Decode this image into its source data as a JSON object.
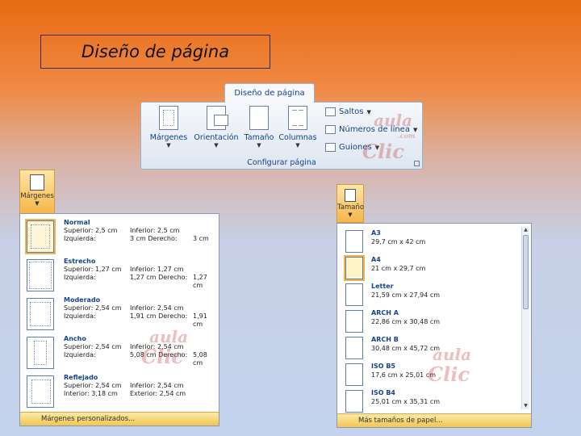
{
  "slide_title": "Diseño de página",
  "ribbon": {
    "tab_label": "Diseño de página",
    "group_label": "Configurar página",
    "buttons": [
      {
        "label": "Márgenes",
        "icon": "margins-icon"
      },
      {
        "label": "Orientación",
        "icon": "orientation-icon"
      },
      {
        "label": "Tamaño",
        "icon": "size-icon"
      },
      {
        "label": "Columnas",
        "icon": "columns-icon"
      }
    ],
    "small_buttons": [
      {
        "label": "Saltos",
        "icon": "breaks-icon"
      },
      {
        "label": "Números de línea",
        "icon": "line-numbers-icon"
      },
      {
        "label": "Guiones",
        "icon": "hyphenation-icon"
      }
    ],
    "watermark": {
      "top": "aula",
      "com": ".com",
      "bottom": "Clic"
    }
  },
  "margins_menu": {
    "button_label": "Márgenes",
    "items": [
      {
        "name": "Normal",
        "line1_a": "Superior: 2,5 cm",
        "line1_b": "Inferior: 2,5 cm",
        "line2_a": "Izquierda:",
        "line2_b": "3 cm Derecho:",
        "line2_c": "3 cm"
      },
      {
        "name": "Estrecho",
        "line1_a": "Superior: 1,27 cm",
        "line1_b": "Inferior: 1,27 cm",
        "line2_a": "Izquierda:",
        "line2_b": "1,27 cm Derecho:",
        "line2_c": "1,27 cm"
      },
      {
        "name": "Moderado",
        "line1_a": "Superior: 2,54 cm",
        "line1_b": "Inferior: 2,54 cm",
        "line2_a": "Izquierda:",
        "line2_b": "1,91 cm Derecho:",
        "line2_c": "1,91 cm"
      },
      {
        "name": "Ancho",
        "line1_a": "Superior: 2,54 cm",
        "line1_b": "Inferior: 2,54 cm",
        "line2_a": "Izquierda:",
        "line2_b": "5,08 cm Derecho:",
        "line2_c": "5,08 cm"
      },
      {
        "name": "Reflejado",
        "line1_a": "Superior: 2,54 cm",
        "line1_b": "Inferior: 2,54 cm",
        "line2_a": "Interior: 3,18 cm",
        "line2_b": "Exterior: 2,54 cm",
        "line2_c": ""
      }
    ],
    "footer": "Márgenes personalizados..."
  },
  "size_menu": {
    "button_label": "Tamaño",
    "items": [
      {
        "name": "A3",
        "dims": "29,7 cm x 42 cm"
      },
      {
        "name": "A4",
        "dims": "21 cm x 29,7 cm"
      },
      {
        "name": "Letter",
        "dims": "21,59 cm x 27,94 cm"
      },
      {
        "name": "ARCH A",
        "dims": "22,86 cm x 30,48 cm"
      },
      {
        "name": "ARCH B",
        "dims": "30,48 cm x 45,72 cm"
      },
      {
        "name": "ISO B5",
        "dims": "17,6 cm x 25,01 cm"
      },
      {
        "name": "ISO B4",
        "dims": "25,01 cm x 35,31 cm"
      }
    ],
    "footer": "Más tamaños de papel..."
  }
}
